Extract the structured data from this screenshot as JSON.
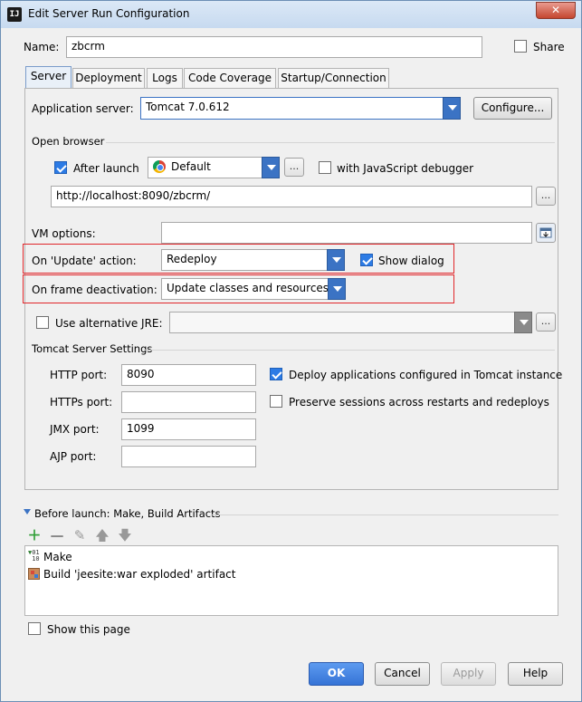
{
  "window": {
    "title": "Edit Server Run Configuration",
    "close_label": "✕"
  },
  "name": {
    "label": "Name:",
    "value": "zbcrm",
    "share_label": "Share"
  },
  "tabs": [
    "Server",
    "Deployment",
    "Logs",
    "Code Coverage",
    "Startup/Connection"
  ],
  "server": {
    "app_server_label": "Application server:",
    "app_server_value": "Tomcat 7.0.612",
    "configure_label": "Configure...",
    "open_browser_label": "Open browser",
    "after_launch_label": "After launch",
    "browser_value": "Default",
    "browse_dots": "...",
    "js_debugger_label": "with JavaScript debugger",
    "url_value": "http://localhost:8090/zbcrm/",
    "vm_options_label": "VM options:",
    "on_update_label": "On 'Update' action:",
    "on_update_value": "Redeploy",
    "show_dialog_label": "Show dialog",
    "on_frame_label": "On frame deactivation:",
    "on_frame_value": "Update classes and resources",
    "alt_jre_label": "Use alternative JRE:",
    "tomcat_settings_label": "Tomcat Server Settings",
    "http_port_label": "HTTP port:",
    "http_port_value": "8090",
    "https_port_label": "HTTPs port:",
    "https_port_value": "",
    "jmx_port_label": "JMX port:",
    "jmx_port_value": "1099",
    "ajp_port_label": "AJP port:",
    "ajp_port_value": "",
    "deploy_apps_label": "Deploy applications configured in Tomcat instance",
    "preserve_sessions_label": "Preserve sessions across restarts and redeploys"
  },
  "before_launch": {
    "label": "Before launch: Make, Build Artifacts",
    "items": [
      "Make",
      "Build 'jeesite:war exploded' artifact"
    ],
    "show_page_label": "Show this page"
  },
  "footer": {
    "ok": "OK",
    "cancel": "Cancel",
    "apply": "Apply",
    "help": "Help"
  },
  "colors": {
    "accent": "#3b73c4",
    "highlight_box": "#e0262a",
    "ok_button": "#3d7fe0"
  }
}
